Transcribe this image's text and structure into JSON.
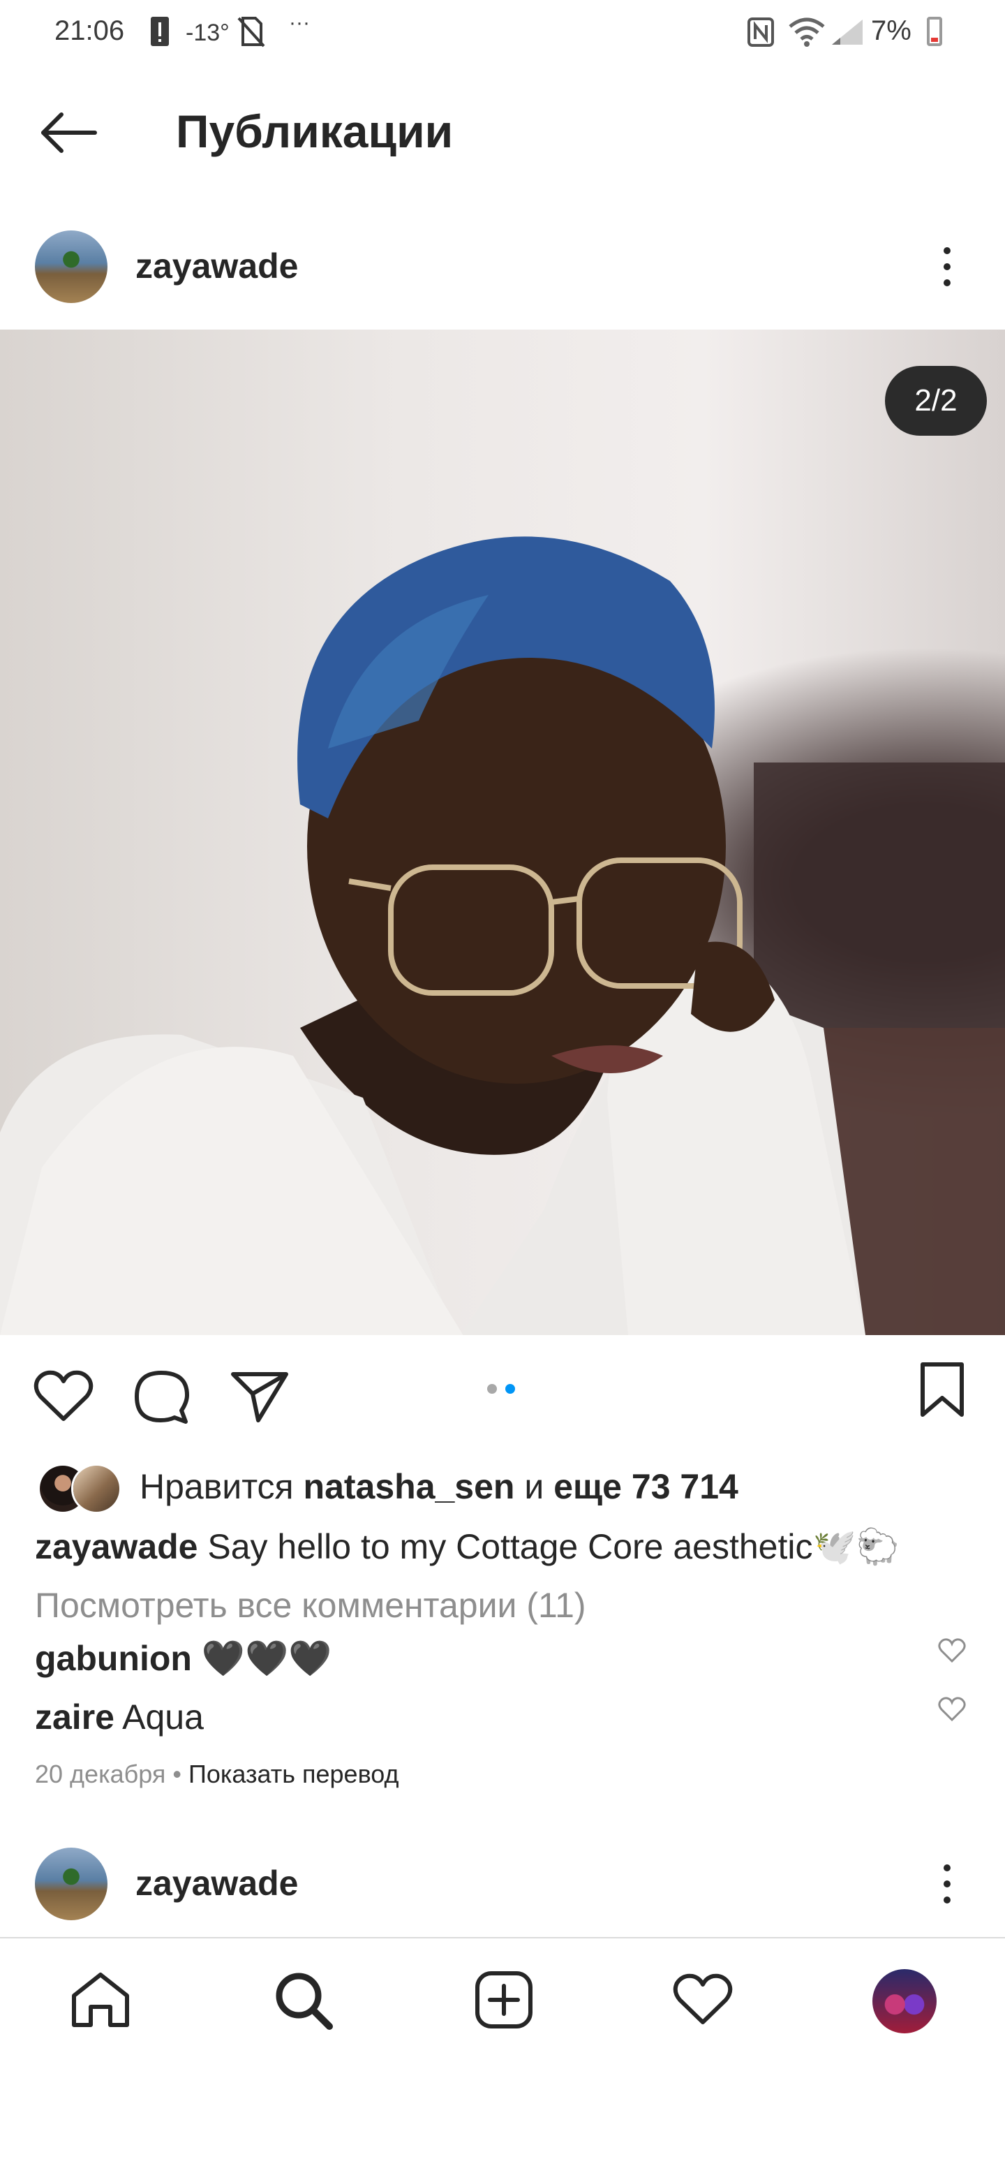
{
  "status_bar": {
    "time": "21:06",
    "temperature": "-13°",
    "more": "···",
    "battery": "7%",
    "icons": [
      "alert-icon",
      "no-sim-icon",
      "nfc-icon",
      "wifi-icon",
      "signal-icon",
      "battery-icon"
    ]
  },
  "header": {
    "title": "Публикации",
    "back_icon": "back-arrow-icon"
  },
  "post": {
    "username": "zayawade",
    "image_counter": "2/2",
    "carousel": {
      "count": 2,
      "active": 2,
      "active_color": "#0095f6",
      "inactive_color": "#a8a8a8"
    },
    "likes": {
      "prefix": "Нравится ",
      "user": "natasha_sen",
      "middle": " и ",
      "count": "еще 73 714"
    },
    "caption": {
      "user": "zayawade",
      "text": " Say hello to my Cottage Core aesthetic🕊️🐑"
    },
    "view_comments": "Посмотреть все комментарии (11)",
    "comments": [
      {
        "user": "gabunion",
        "text": " 🖤🖤🖤"
      },
      {
        "user": "zaire",
        "text": " Aqua"
      }
    ],
    "date": "20 декабря",
    "separator": " • ",
    "translate": "Показать перевод"
  },
  "next_post": {
    "username": "zayawade"
  },
  "nav": [
    "home-icon",
    "search-icon",
    "new-post-icon",
    "activity-icon",
    "profile-avatar"
  ],
  "colors": {
    "text": "#262626",
    "secondary": "#8e8e8e",
    "accent": "#0095f6"
  }
}
